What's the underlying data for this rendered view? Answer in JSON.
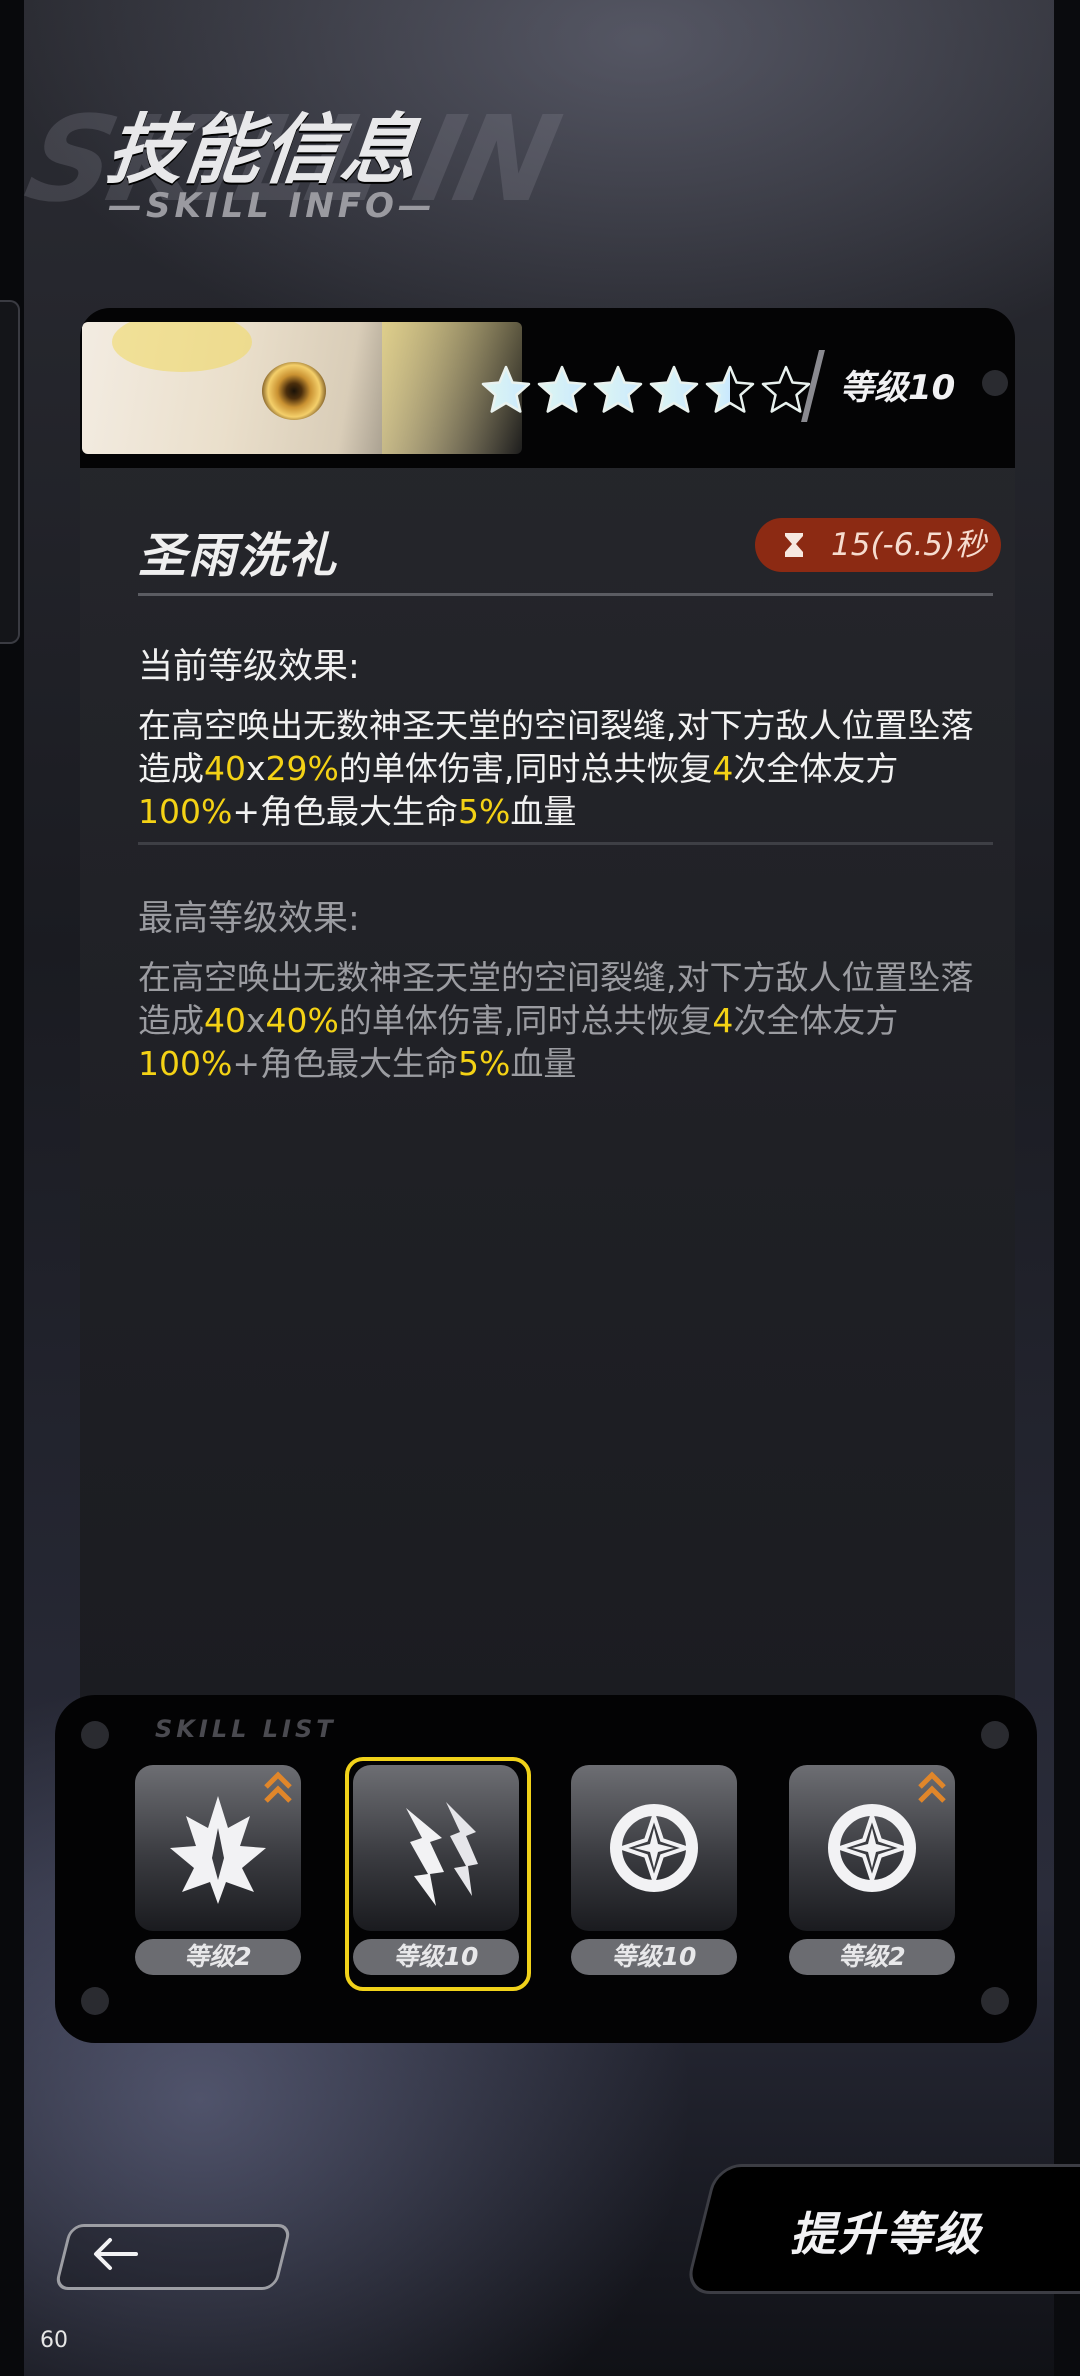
{
  "header": {
    "title": "技能信息",
    "subtitle": "—SKILL INFO—",
    "watermark": "SKILL IN"
  },
  "skill": {
    "level_badge": "等级10",
    "stars_filled": 4.5,
    "stars_total": 6,
    "name": "圣雨洗礼",
    "cooldown": "15(-6.5)秒"
  },
  "current_effect": {
    "title": "当前等级效果:",
    "parts": [
      {
        "t": "在高空唤出无数神圣天堂的空间裂缝,对下方敌人位置坠落造成"
      },
      {
        "t": "40",
        "hl": true
      },
      {
        "t": "x"
      },
      {
        "t": "29%",
        "hl": true
      },
      {
        "t": "的单体伤害,同时总共恢复"
      },
      {
        "t": "4",
        "hl": true
      },
      {
        "t": "次全体友方"
      },
      {
        "t": "100%",
        "hl": true
      },
      {
        "t": "+角色最大生命"
      },
      {
        "t": "5%",
        "hl": true
      },
      {
        "t": "血量"
      }
    ]
  },
  "max_effect": {
    "title": "最高等级效果:",
    "parts": [
      {
        "t": "在高空唤出无数神圣天堂的空间裂缝,对下方敌人位置坠落造成"
      },
      {
        "t": "40",
        "hl": true
      },
      {
        "t": "x"
      },
      {
        "t": "40%",
        "hl": true
      },
      {
        "t": "的单体伤害,同时总共恢复"
      },
      {
        "t": "4",
        "hl": true
      },
      {
        "t": "次全体友方"
      },
      {
        "t": "100%",
        "hl": true
      },
      {
        "t": "+角色最大生命"
      },
      {
        "t": "5%",
        "hl": true
      },
      {
        "t": "血量"
      }
    ]
  },
  "skill_list": {
    "title": "SKILL LIST",
    "slots": [
      {
        "label": "等级2",
        "icon": "flame-crest-icon",
        "upgradable": true,
        "selected": false
      },
      {
        "label": "等级10",
        "icon": "holy-rain-icon",
        "upgradable": false,
        "selected": true
      },
      {
        "label": "等级10",
        "icon": "compass-star-icon",
        "upgradable": false,
        "selected": false
      },
      {
        "label": "等级2",
        "icon": "compass-star-icon",
        "upgradable": true,
        "selected": false
      }
    ]
  },
  "buttons": {
    "back_icon": "back-arrow-icon",
    "upgrade_label": "提升等级"
  },
  "overlay": {
    "fps": "60"
  },
  "colors": {
    "highlight": "#f4d215",
    "cooldown_bg": "#8c2a13",
    "selected_border": "#f1d21a",
    "upgrade_arrow": "#e0862a"
  }
}
